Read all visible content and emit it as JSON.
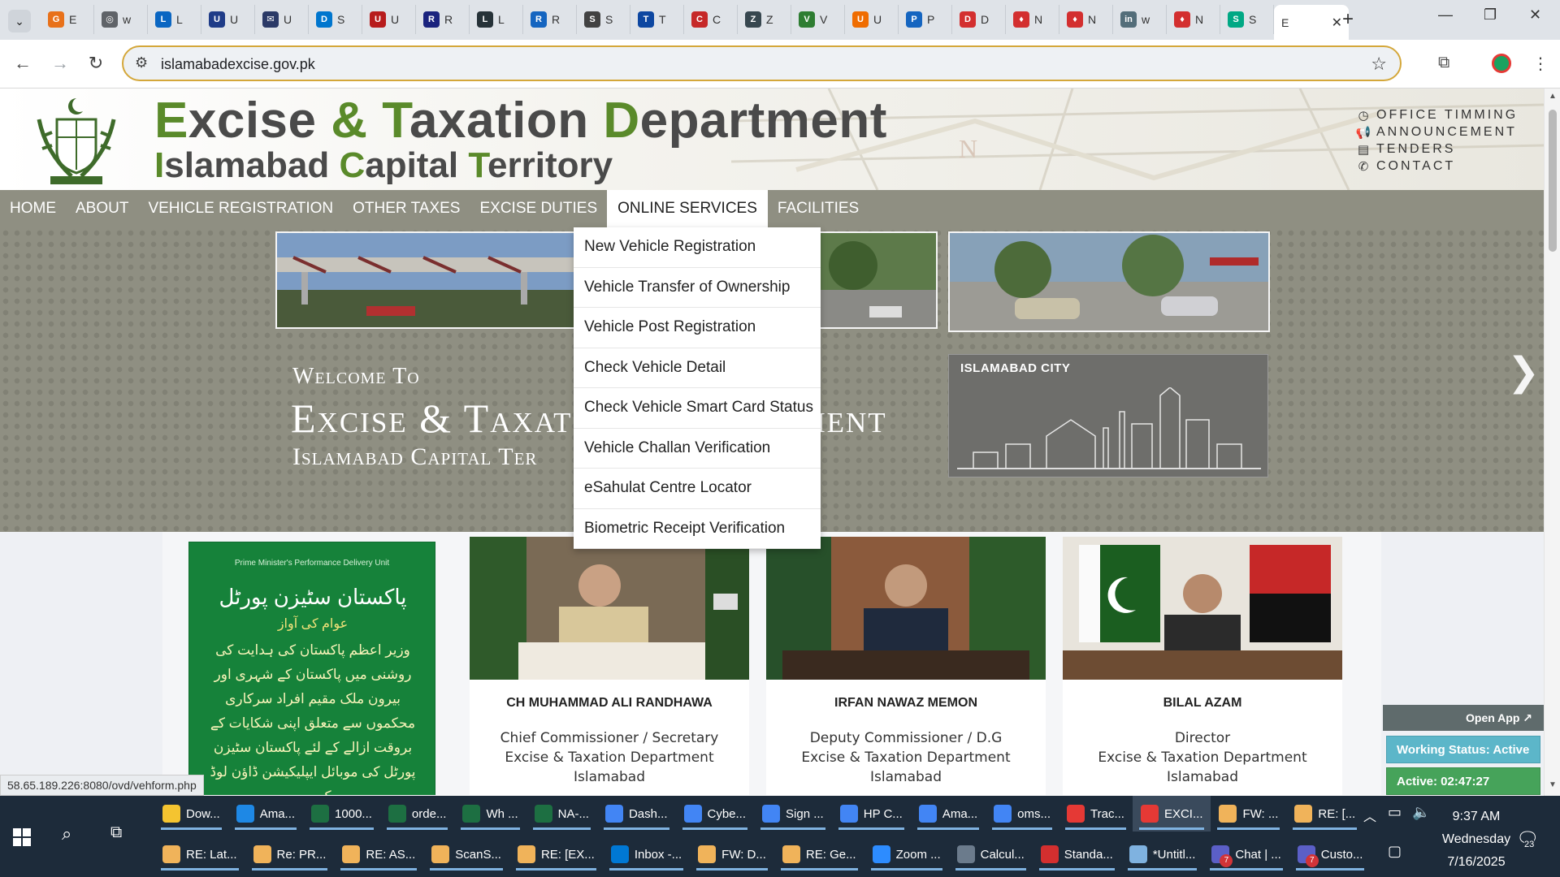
{
  "browser": {
    "tabs": [
      {
        "label": "E",
        "icon": "chrome-icon",
        "color": "#e8711a",
        "glyph": "G"
      },
      {
        "label": "w",
        "icon": "globe-icon",
        "color": "#5f6368",
        "glyph": "◎"
      },
      {
        "label": "L",
        "icon": "linkedin-icon",
        "color": "#0a66c2",
        "glyph": "L"
      },
      {
        "label": "U",
        "icon": "u-icon",
        "color": "#1f3c88",
        "glyph": "U"
      },
      {
        "label": "U",
        "icon": "mail-icon",
        "color": "#2b3a67",
        "glyph": "✉"
      },
      {
        "label": "S",
        "icon": "dell-icon",
        "color": "#0076ce",
        "glyph": "D"
      },
      {
        "label": "U",
        "icon": "u-red-icon",
        "color": "#b71c1c",
        "glyph": "U"
      },
      {
        "label": "R",
        "icon": "r-icon",
        "color": "#1a237e",
        "glyph": "R"
      },
      {
        "label": "L",
        "icon": "l-icon",
        "color": "#263238",
        "glyph": "L"
      },
      {
        "label": "R",
        "icon": "r2-icon",
        "color": "#1565c0",
        "glyph": "R"
      },
      {
        "label": "S",
        "icon": "s-icon",
        "color": "#424242",
        "glyph": "S"
      },
      {
        "label": "T",
        "icon": "t-icon",
        "color": "#0d47a1",
        "glyph": "T"
      },
      {
        "label": "C",
        "icon": "c-icon",
        "color": "#c62828",
        "glyph": "C"
      },
      {
        "label": "Z",
        "icon": "z-icon",
        "color": "#37474f",
        "glyph": "Z"
      },
      {
        "label": "V",
        "icon": "v-icon",
        "color": "#2e7d32",
        "glyph": "V"
      },
      {
        "label": "U",
        "icon": "u-orange-icon",
        "color": "#ef6c00",
        "glyph": "U"
      },
      {
        "label": "P",
        "icon": "p-icon",
        "color": "#1565c0",
        "glyph": "P"
      },
      {
        "label": "D",
        "icon": "d-icon",
        "color": "#d32f2f",
        "glyph": "D"
      },
      {
        "label": "N",
        "icon": "shield-icon",
        "color": "#d32f2f",
        "glyph": "♦"
      },
      {
        "label": "N",
        "icon": "shield-icon",
        "color": "#d32f2f",
        "glyph": "♦"
      },
      {
        "label": "w",
        "icon": "linkedin-circle-icon",
        "color": "#546e7a",
        "glyph": "in"
      },
      {
        "label": "N",
        "icon": "shield-icon",
        "color": "#d32f2f",
        "glyph": "♦"
      },
      {
        "label": "S",
        "icon": "sheet-icon",
        "color": "#00a884",
        "glyph": "S"
      }
    ],
    "active_tab_label": "E",
    "url": "islamabadexcise.gov.pk"
  },
  "site": {
    "title_line1_parts": [
      "E",
      "xcise ",
      "&",
      " ",
      "T",
      "axation ",
      "D",
      "epartment"
    ],
    "title_line2_parts": [
      "I",
      "slamabad ",
      "C",
      "apital ",
      "T",
      "erritory"
    ],
    "top_links": [
      {
        "label": "OFFICE TIMMING",
        "icon": "clock-icon",
        "glyph": "◷"
      },
      {
        "label": "ANNOUNCEMENT",
        "icon": "megaphone-icon",
        "glyph": "📢"
      },
      {
        "label": "TENDERS",
        "icon": "document-icon",
        "glyph": "▤"
      },
      {
        "label": "CONTACT",
        "icon": "phone-icon",
        "glyph": "✆"
      }
    ],
    "nav": [
      "HOME",
      "ABOUT",
      "VEHICLE REGISTRATION",
      "OTHER TAXES",
      "EXCISE DUTIES",
      "ONLINE SERVICES",
      "FACILITIES"
    ],
    "online_services_menu": [
      "New Vehicle Registration",
      "Vehicle Transfer of Ownership",
      "Vehicle Post Registration",
      "Check Vehicle Detail",
      "Check Vehicle Smart Card Status",
      "Vehicle Challan Verification",
      "eSahulat Centre Locator",
      "Biometric Receipt Verification"
    ],
    "welcome": {
      "line1": "Welcome To",
      "line2": "Excise & Taxat",
      "line2b": "ment",
      "line3": "Islamabad Capital Ter"
    },
    "city_box_label": "ISLAMABAD CITY",
    "citizen_portal": {
      "pm_unit": "Prime Minister's Performance Delivery Unit",
      "urdu_title": "پاکستان سٹیزن پورٹل",
      "urdu_sub": "عوام کی آواز",
      "urdu_body": "وزیر اعظم پاکستان کی ہدایت کی روشنی میں پاکستان کے شہری اور بیرون ملک مقیم افراد سرکاری محکموں سے متعلق اپنی شکایات کے بروقت ازالے کے لئے پاکستان سٹیزن پورٹل کی موبائل ایپلیکیشن ڈاؤن لوڈ کریں۔"
    },
    "officials": [
      {
        "name": "CH MUHAMMAD ALI RANDHAWA",
        "role1": "Chief Commissioner / Secretary",
        "role2": "Excise & Taxation Department",
        "role3": "Islamabad"
      },
      {
        "name": "IRFAN NAWAZ MEMON",
        "role1": "Deputy Commissioner / D.G",
        "role2": "Excise & Taxation Department",
        "role3": "Islamabad"
      },
      {
        "name": "BILAL AZAM",
        "role1": "Director",
        "role2": "Excise & Taxation Department",
        "role3": "Islamabad"
      }
    ],
    "widget": {
      "open_app": "Open App ↗",
      "working_status": "Working Status: Active",
      "active_time": "Active: 02:47:27"
    },
    "status_url": "58.65.189.226:8080/ovd/vehform.php"
  },
  "taskbar": {
    "row1": [
      {
        "label": "Dow...",
        "color": "#f4c430"
      },
      {
        "label": "Ama...",
        "color": "#1e88e5"
      },
      {
        "label": "1000...",
        "color": "#1d6f42"
      },
      {
        "label": "orde...",
        "color": "#1d6f42"
      },
      {
        "label": "Wh ...",
        "color": "#1d6f42"
      },
      {
        "label": "NA-...",
        "color": "#1d6f42"
      },
      {
        "label": "Dash...",
        "color": "#4285f4"
      },
      {
        "label": "Cybe...",
        "color": "#4285f4"
      },
      {
        "label": "Sign ...",
        "color": "#4285f4"
      },
      {
        "label": "HP C...",
        "color": "#4285f4"
      },
      {
        "label": "Ama...",
        "color": "#4285f4"
      },
      {
        "label": "oms...",
        "color": "#4285f4"
      },
      {
        "label": "Trac...",
        "color": "#e53935"
      },
      {
        "label": "EXCI...",
        "color": "#e53935"
      },
      {
        "label": "FW: ...",
        "color": "#f0b35a"
      },
      {
        "label": "RE: [...",
        "color": "#f0b35a"
      }
    ],
    "row2": [
      {
        "label": "RE: Lat...",
        "color": "#f0b35a"
      },
      {
        "label": "Re: PR...",
        "color": "#f0b35a"
      },
      {
        "label": "RE: AS...",
        "color": "#f0b35a"
      },
      {
        "label": "ScanS...",
        "color": "#f0b35a"
      },
      {
        "label": "RE: [EX...",
        "color": "#f0b35a"
      },
      {
        "label": "Inbox -...",
        "color": "#0078d4"
      },
      {
        "label": "FW: D...",
        "color": "#f0b35a"
      },
      {
        "label": "RE: Ge...",
        "color": "#f0b35a"
      },
      {
        "label": "Zoom ...",
        "color": "#2d8cff"
      },
      {
        "label": "Calcul...",
        "color": "#6b7b8c"
      },
      {
        "label": "Standa...",
        "color": "#d32f2f"
      },
      {
        "label": "*Untitl...",
        "color": "#7fb2e0"
      },
      {
        "label": "Chat | ...",
        "color": "#5b5fc7",
        "badge": "7"
      },
      {
        "label": "Custo...",
        "color": "#5b5fc7",
        "badge": "7"
      }
    ],
    "time": "9:37 AM",
    "day": "Wednesday",
    "date": "7/16/2025",
    "notification_count": "23"
  }
}
